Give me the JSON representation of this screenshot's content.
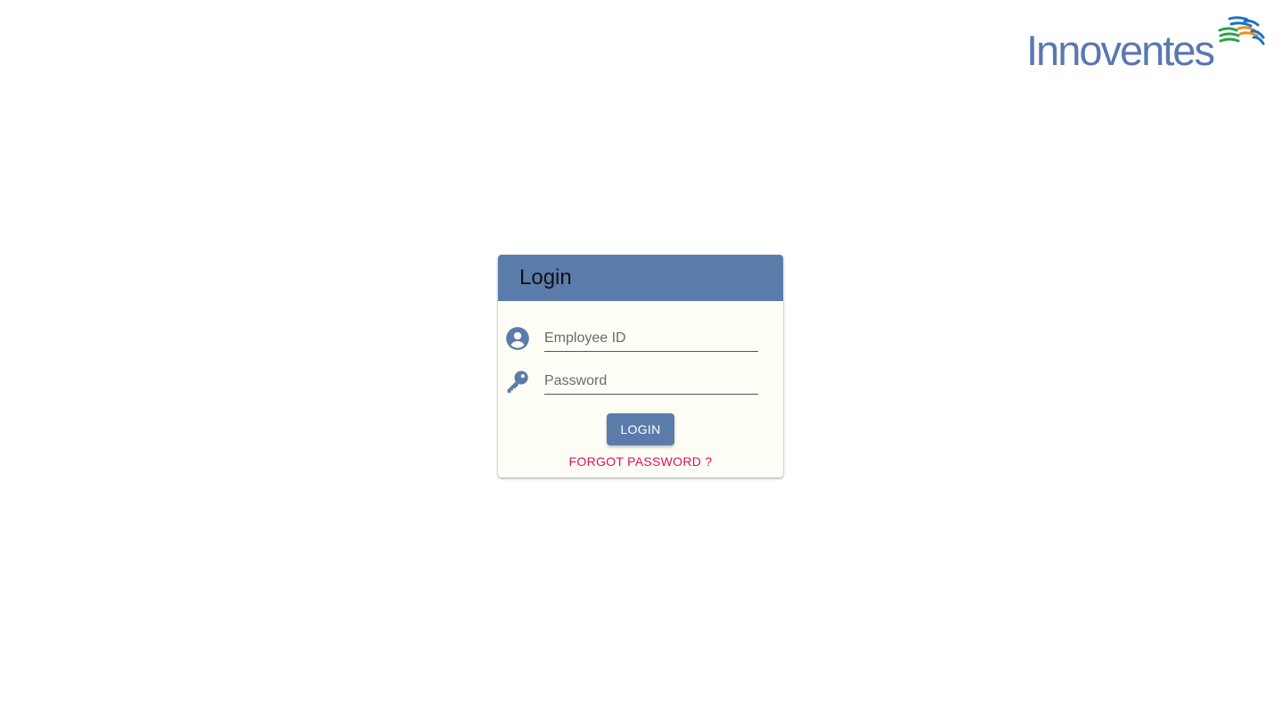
{
  "brand": {
    "name": "Innoventes",
    "text_color": "#5a78b0",
    "mark_colors": [
      "#1b72c4",
      "#2aa148",
      "#f28a1d"
    ]
  },
  "login_card": {
    "title": "Login",
    "header_color": "#5b7caa",
    "employee_id": {
      "placeholder": "Employee ID",
      "value": "",
      "icon": "account-circle-icon"
    },
    "password": {
      "placeholder": "Password",
      "value": "",
      "icon": "key-icon"
    },
    "login_button_label": "LOGIN",
    "forgot_password_label": "FORGOT PASSWORD ?",
    "forgot_password_color": "#e0105a"
  }
}
